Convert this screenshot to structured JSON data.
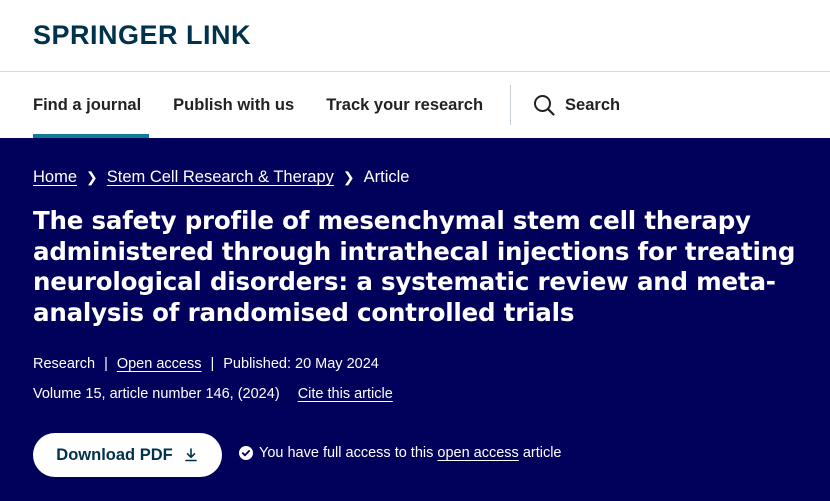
{
  "brand": {
    "logo_text": "SPRINGER LINK"
  },
  "nav": {
    "items": [
      {
        "label": "Find a journal",
        "active": true
      },
      {
        "label": "Publish with us"
      },
      {
        "label": "Track your research"
      }
    ],
    "search_label": "Search"
  },
  "breadcrumb": {
    "home": "Home",
    "journal": "Stem Cell Research & Therapy",
    "current": "Article"
  },
  "article": {
    "title": "The safety profile of mesenchymal stem cell therapy administered through intrathecal injections for treating neurological disorders: a systematic review and meta-analysis of randomised controlled trials",
    "type": "Research",
    "open_access": "Open access",
    "published": "Published: 20 May 2024",
    "volume_info": "Volume 15, article number 146, (2024)",
    "cite": "Cite this article"
  },
  "actions": {
    "download_label": "Download PDF"
  },
  "access": {
    "prefix": "You have full access to this",
    "link": "open access",
    "suffix": "article"
  },
  "colors": {
    "hero_bg": "#01005a",
    "brand": "#01324b",
    "active_tab": "#0f7c99"
  }
}
